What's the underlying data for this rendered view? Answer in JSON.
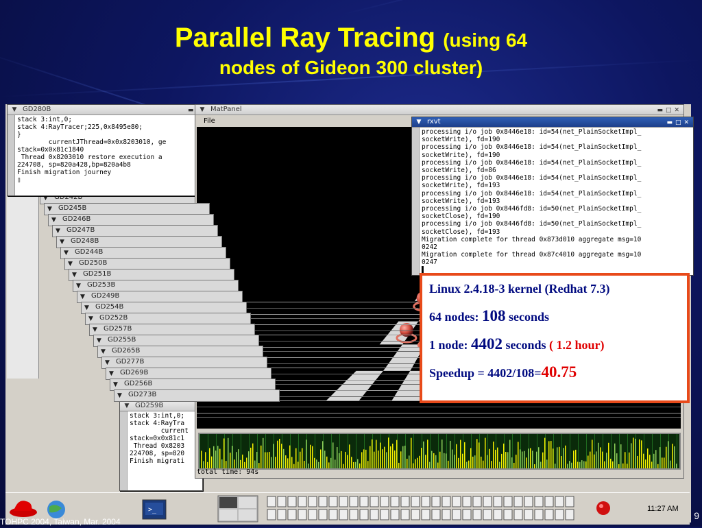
{
  "slide": {
    "title_main": "Parallel Ray Tracing",
    "title_paren": "(using 64",
    "title_line2": "nodes of Gideon 300 cluster)",
    "footer": "TOHPC 2004, Taiwan, Mar. 2004",
    "page_number": "9"
  },
  "colors": {
    "title": "#ffff00",
    "info_border": "#e84a1a",
    "info_text": "#000a80",
    "info_accent": "#e00000"
  },
  "front_window": {
    "title": "GD280B",
    "lines": [
      "stack 3:int,0;",
      "stack 4:RayTracer;225,0x8495e80;",
      "}",
      "",
      "        currentJThread=0x0x8203010, ge",
      "stack=0x0x81c1840",
      " Thread 0x8203010 restore execution a",
      "224708, sp=820a428,bp=820a4b8",
      "Finish migration journey",
      "▯"
    ]
  },
  "stacked_windows": [
    "GD242B",
    "GD245B",
    "GD246B",
    "GD247B",
    "GD248B",
    "GD244B",
    "GD250B",
    "GD251B",
    "GD253B",
    "GD249B",
    "GD254B",
    "GD252B",
    "GD257B",
    "GD255B",
    "GD265B",
    "GD277B",
    "GD269B",
    "GD256B",
    "GD273B"
  ],
  "bottom_window": {
    "title": "GD259B",
    "lines": [
      "stack 3:int,0;",
      "stack 4:RayTra",
      "",
      "        current",
      "stack=0x0x81c1",
      " Thread 0x8203",
      "224708, sp=820",
      "Finish migrati"
    ]
  },
  "matpanel": {
    "title": "MatPanel",
    "menu_file": "File",
    "status": "total time: 94s"
  },
  "rxvt": {
    "title": "rxvt",
    "lines": [
      "processing i/o job 0x8446e18: id=54(net_PlainSocketImpl_",
      "socketWrite), fd=190",
      "processing i/o job 0x8446e18: id=54(net_PlainSocketImpl_",
      "socketWrite), fd=190",
      "processing i/o job 0x8446e18: id=54(net_PlainSocketImpl_",
      "socketWrite), fd=86",
      "processing i/o job 0x8446e18: id=54(net_PlainSocketImpl_",
      "socketWrite), fd=193",
      "processing i/o job 0x8446e18: id=54(net_PlainSocketImpl_",
      "socketWrite), fd=193",
      "processing i/o job 0x8446fd8: id=50(net_PlainSocketImpl_",
      "socketClose), fd=190",
      "processing i/o job 0x8446fd8: id=50(net_PlainSocketImpl_",
      "socketClose), fd=193",
      "Migration complete for thread 0x873d010 aggregate msg=10",
      "0242",
      "Migration complete for thread 0x87c4010 aggregate msg=10",
      "0247",
      "▌"
    ]
  },
  "info": {
    "line1": "Linux 2.4.18-3 kernel (Redhat 7.3)",
    "line2_label": "64 nodes:",
    "line2_value": "108",
    "line2_unit": "seconds",
    "line3_label": "1 node:",
    "line3_value": "4402",
    "line3_unit": "seconds",
    "line3_note": "( 1.2 hour)",
    "line4_label": "Speedup = 4402/108=",
    "line4_value": "40.75"
  },
  "taskbar": {
    "clock": "11:27 AM"
  }
}
